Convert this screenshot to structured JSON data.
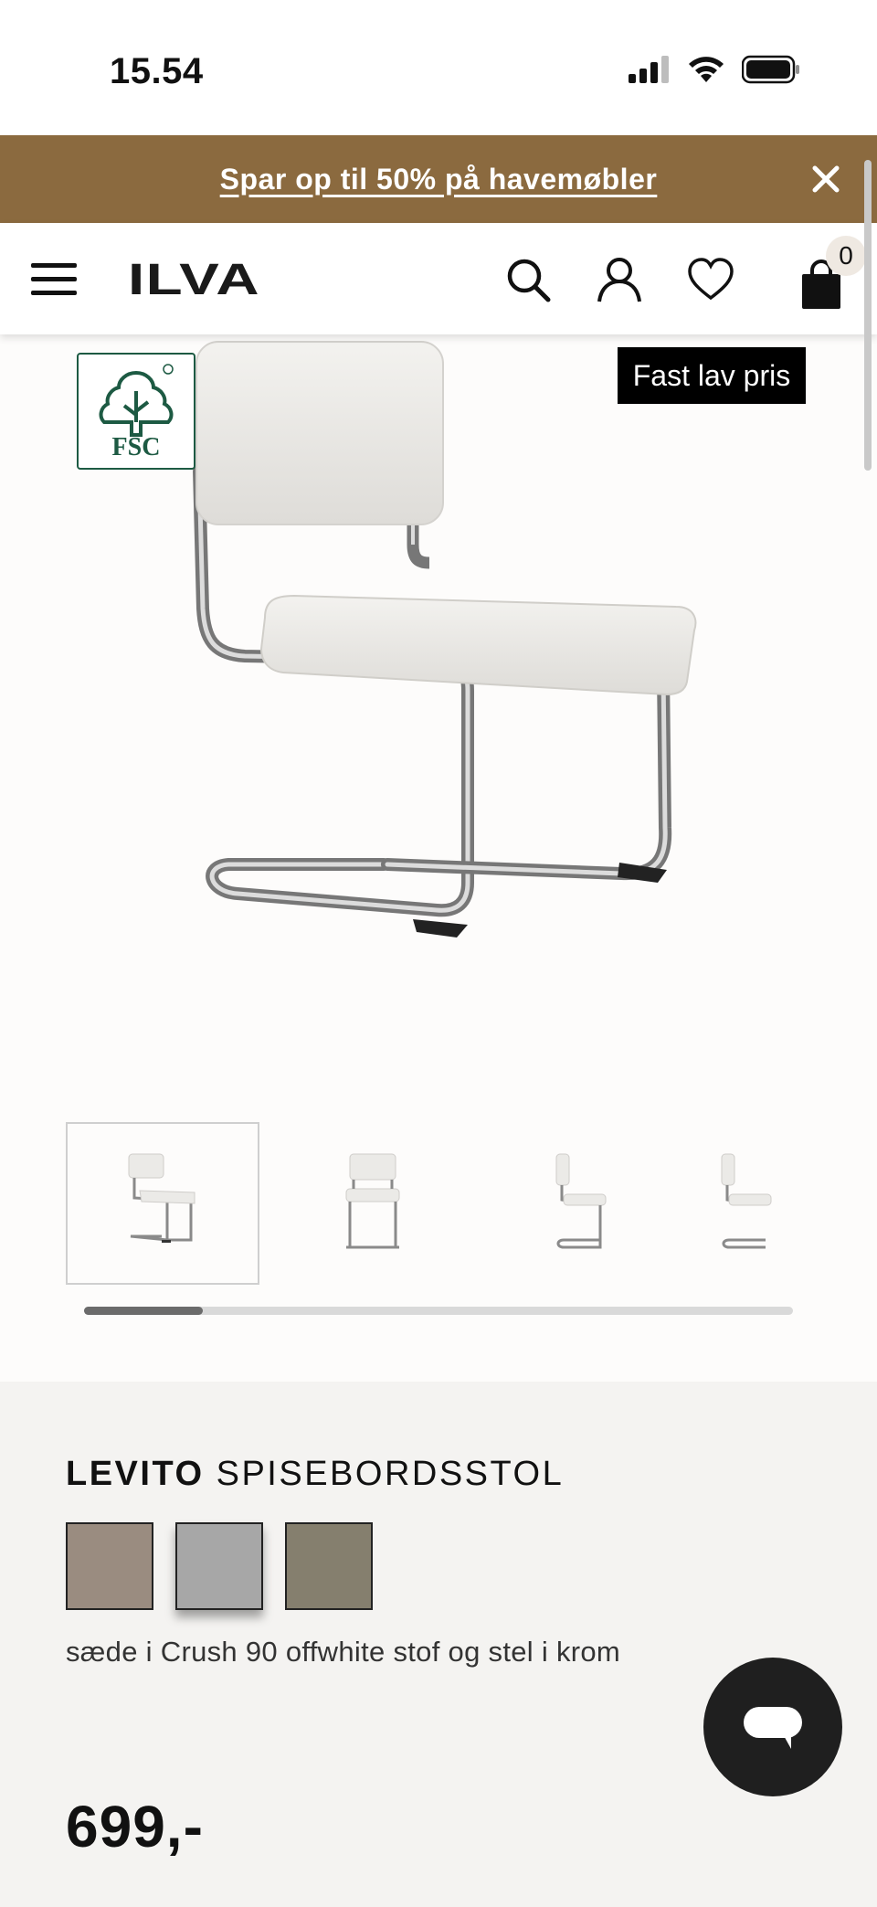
{
  "status_bar": {
    "time": "15.54"
  },
  "promo": {
    "text": "Spar op til 50% på havemøbler"
  },
  "header": {
    "logo": "ILVA",
    "cart_count": "0"
  },
  "hero": {
    "badge_fsc": "FSC",
    "price_tag": "Fast lav pris"
  },
  "thumbnails": {
    "count": 4,
    "active_index": 0,
    "scroll_position": 0.0
  },
  "product": {
    "brand": "LEVITO",
    "name": "SPISEBORDSSTOL",
    "swatches": [
      {
        "color": "#9a8c80",
        "label": "beige"
      },
      {
        "color": "#a7a7a7",
        "label": "grey"
      },
      {
        "color": "#857f6e",
        "label": "olive"
      }
    ],
    "selected_swatch_index": 1,
    "variant_description": "sæde i Crush 90 offwhite stof og stel i krom",
    "price": "699,-"
  },
  "colors": {
    "promo_bg": "#8b6a3f",
    "info_bg": "#f4f3f1",
    "chat_bg": "#1f1f1f",
    "fsc_green": "#1d5a43"
  }
}
